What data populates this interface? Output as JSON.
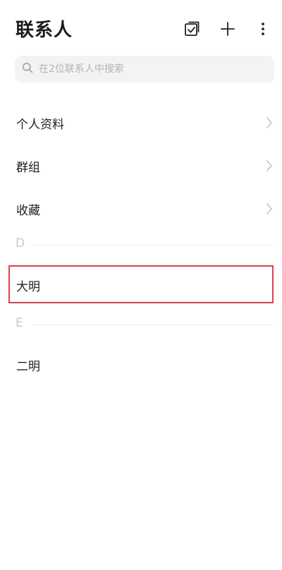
{
  "header": {
    "title": "联系人",
    "icons": [
      "select-icon",
      "add-icon",
      "more-icon"
    ]
  },
  "search": {
    "placeholder": "在2位联系人中搜索",
    "value": ""
  },
  "menu": {
    "items": [
      {
        "label": "个人资料",
        "icon": "chevron-right-icon"
      },
      {
        "label": "群组",
        "icon": "chevron-right-icon"
      },
      {
        "label": "收藏",
        "icon": "chevron-right-icon"
      }
    ]
  },
  "contacts": {
    "sections": [
      {
        "letter": "D",
        "contacts": [
          "大明"
        ]
      },
      {
        "letter": "E",
        "contacts": [
          "二明"
        ]
      }
    ]
  },
  "colors": {
    "highlight": "#d9434a",
    "search_bg": "#f3f3f3",
    "section_letter": "#c9c9c9"
  }
}
